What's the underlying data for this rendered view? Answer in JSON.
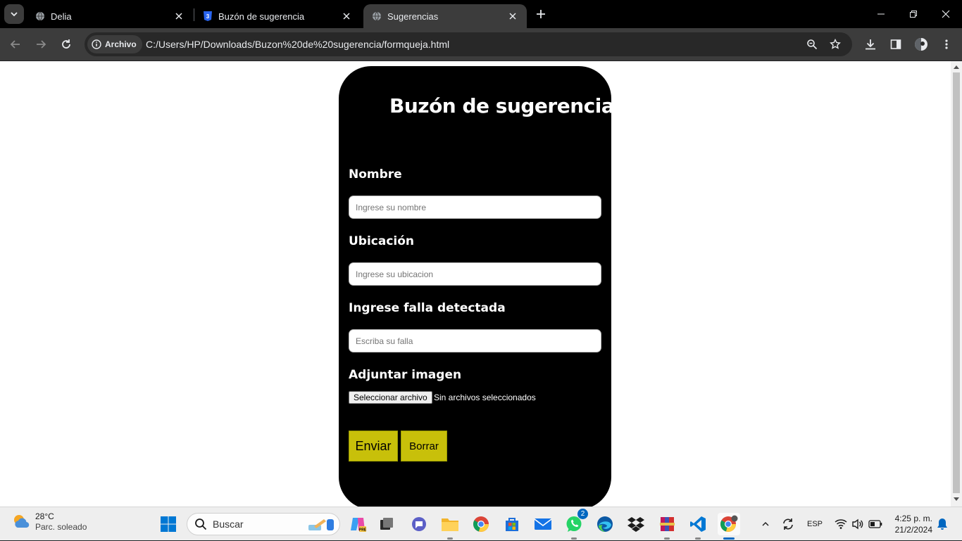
{
  "browser": {
    "tabs": [
      {
        "title": "Delia",
        "active": false
      },
      {
        "title": "Buzón de sugerencia",
        "active": false
      },
      {
        "title": "Sugerencias",
        "active": true
      }
    ],
    "address": {
      "chip_label": "Archivo",
      "url": "C:/Users/HP/Downloads/Buzon%20de%20sugerencia/formqueja.html"
    }
  },
  "form": {
    "title": "Buzón de sugerencias",
    "fields": [
      {
        "label": "Nombre",
        "placeholder": "Ingrese su nombre",
        "value": ""
      },
      {
        "label": "Ubicación",
        "placeholder": "Ingrese su ubicacion",
        "value": ""
      },
      {
        "label": "Ingrese falla detectada",
        "placeholder": "Escriba su falla",
        "value": ""
      }
    ],
    "attach_label": "Adjuntar imagen",
    "file_button": "Seleccionar archivo",
    "file_status": "Sin archivos seleccionados",
    "submit_label": "Enviar",
    "reset_label": "Borrar",
    "colors": {
      "card": "#000000",
      "button": "#c8c00a",
      "page": "#ffffff"
    }
  },
  "taskbar": {
    "weather": {
      "temp": "28°C",
      "condition": "Parc. soleado"
    },
    "search_label": "Buscar",
    "language": "ESP",
    "time": "4:25 p. m.",
    "date": "21/2/2024",
    "whatsapp_badge": "2",
    "apps": [
      "start-icon",
      "search-icon",
      "copilot-icon",
      "task-view-icon",
      "teams-icon",
      "file-explorer-icon",
      "chrome-icon",
      "microsoft-store-icon",
      "mail-icon",
      "whatsapp-icon",
      "edge-icon",
      "dropbox-icon",
      "winrar-icon",
      "vscode-icon",
      "chrome-profile-icon"
    ]
  }
}
